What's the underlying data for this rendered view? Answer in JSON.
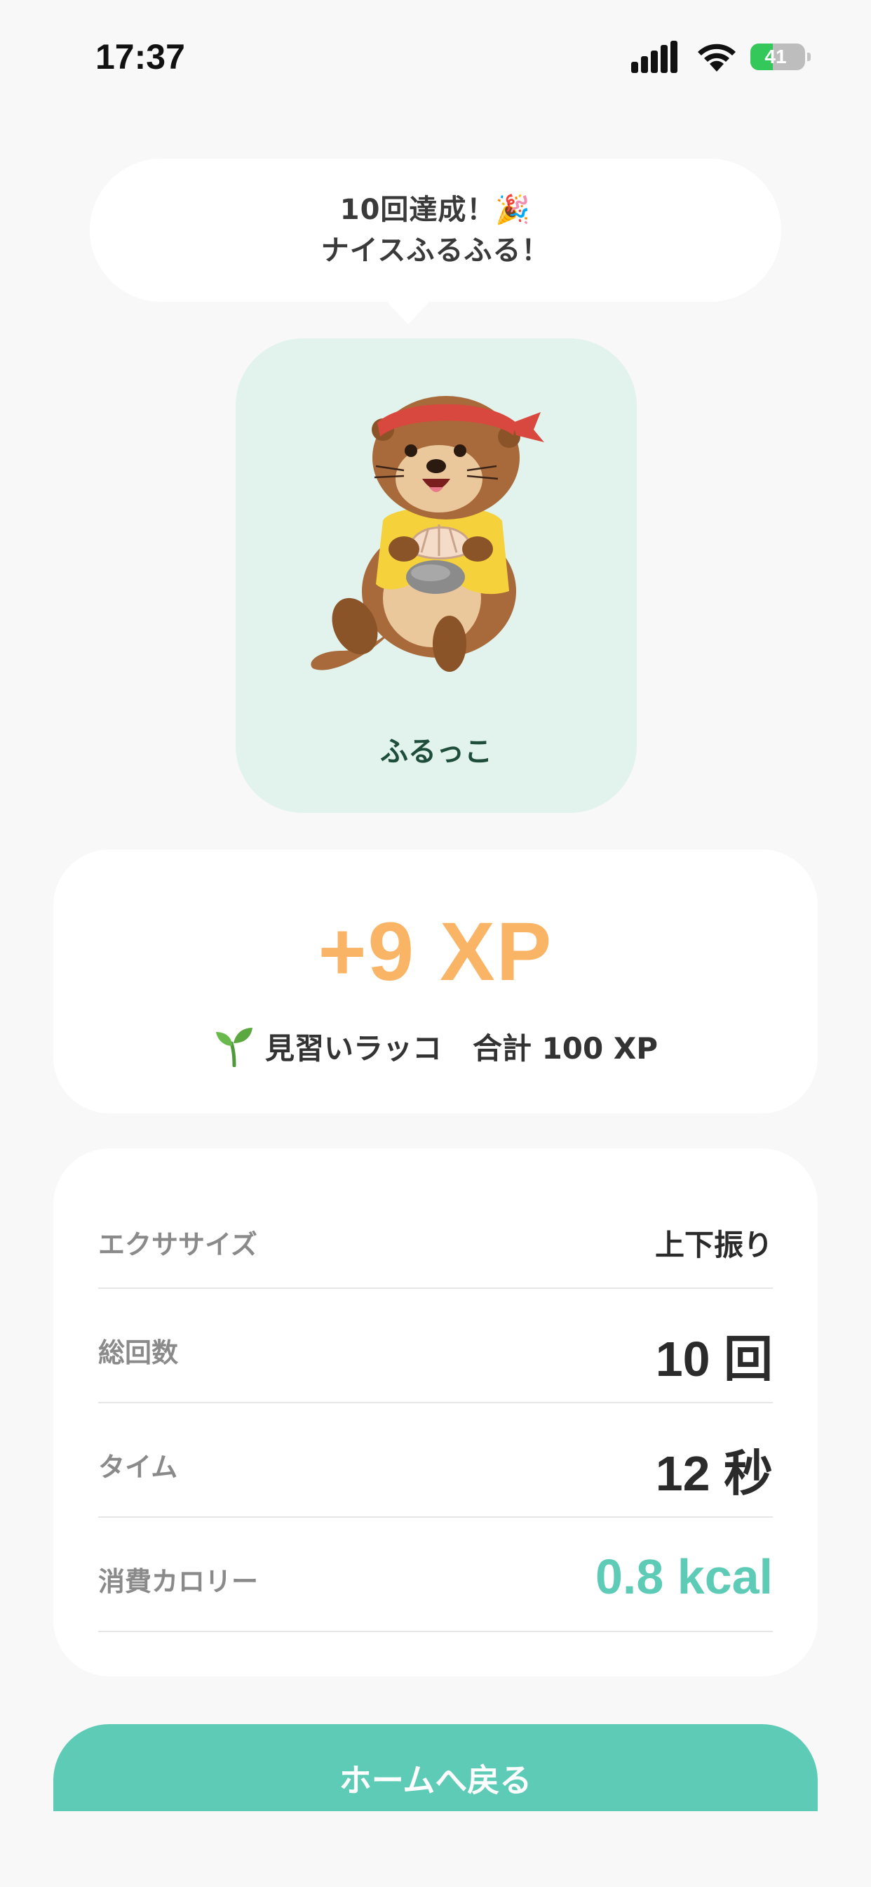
{
  "status_bar": {
    "time": "17:37",
    "battery_percent": "41",
    "battery_level": 0.41,
    "icons": [
      "signal-icon",
      "wifi-icon",
      "battery-icon"
    ]
  },
  "bubble": {
    "line1": "10回達成！🎉",
    "line2": "ナイスふるふる！"
  },
  "mascot": {
    "name": "ふるっこ",
    "image": "otter-mascot-illustration"
  },
  "xp": {
    "gained": "+9 XP",
    "rank_icon": "sprout-icon",
    "rank": "見習いラッコ",
    "total": "合計 100 XP"
  },
  "stats": {
    "exercise_label": "エクササイズ",
    "exercise_value": "上下振り",
    "count_label": "総回数",
    "count_value": "10 回",
    "time_label": "タイム",
    "time_value": "12 秒",
    "calorie_label": "消費カロリー",
    "calorie_value": "0.8 kcal"
  },
  "home_button": {
    "label": "ホームへ戻る"
  },
  "colors": {
    "accent_teal": "#5ecbb6",
    "xp_orange": "#f9b466",
    "mascot_bg": "#e1f3ec",
    "page_bg": "#f8f8f8"
  }
}
